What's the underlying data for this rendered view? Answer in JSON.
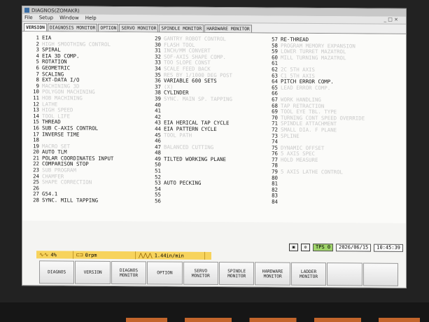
{
  "window": {
    "title": "DIAGNOS(ZOMAKR)",
    "controls": "_ □ ×"
  },
  "menu": [
    "File",
    "Setup",
    "Window",
    "Help"
  ],
  "tabs": [
    {
      "label": "VERSION",
      "active": true
    },
    {
      "label": "DIAGNOSIS MONITOR",
      "active": false
    },
    {
      "label": "OPTION",
      "active": false
    },
    {
      "label": "SERVO MONITOR",
      "active": false
    },
    {
      "label": "SPINDLE MONITOR",
      "active": false
    },
    {
      "label": "HARDWARE MONITOR",
      "active": false
    }
  ],
  "options_col1": [
    {
      "num": "1",
      "label": "EIA",
      "enabled": true
    },
    {
      "num": "2",
      "label": "HIGH SMOOTHING CONTROL",
      "enabled": false
    },
    {
      "num": "3",
      "label": "SPIRAL",
      "enabled": true
    },
    {
      "num": "4",
      "label": "EIA 3D COMP.",
      "enabled": true
    },
    {
      "num": "5",
      "label": "ROTATION",
      "enabled": true
    },
    {
      "num": "6",
      "label": "GEOMETRIC",
      "enabled": true
    },
    {
      "num": "7",
      "label": "SCALING",
      "enabled": true
    },
    {
      "num": "8",
      "label": "EXT-DATA I/O",
      "enabled": true
    },
    {
      "num": "9",
      "label": "MACHINING 3D",
      "enabled": false
    },
    {
      "num": "10",
      "label": "POLYGON MACHINING",
      "enabled": false
    },
    {
      "num": "11",
      "label": "HOB MACHINING",
      "enabled": false
    },
    {
      "num": "12",
      "label": "LATHE",
      "enabled": false
    },
    {
      "num": "13",
      "label": "HIGH SPEED",
      "enabled": false
    },
    {
      "num": "14",
      "label": "TOOL LIFE",
      "enabled": false
    },
    {
      "num": "15",
      "label": "THREAD",
      "enabled": true
    },
    {
      "num": "16",
      "label": "SUB C-AXIS CONTROL",
      "enabled": true
    },
    {
      "num": "17",
      "label": "INVERSE TIME",
      "enabled": true
    },
    {
      "num": "18",
      "label": "",
      "enabled": true
    },
    {
      "num": "19",
      "label": "MACRO SET",
      "enabled": false
    },
    {
      "num": "20",
      "label": "AUTO TLM",
      "enabled": true
    },
    {
      "num": "21",
      "label": "POLAR COORDINATES INPUT",
      "enabled": true
    },
    {
      "num": "22",
      "label": "COMPARISON STOP",
      "enabled": true
    },
    {
      "num": "23",
      "label": "SUB PROGRAM",
      "enabled": false
    },
    {
      "num": "24",
      "label": "CHAMFER",
      "enabled": false
    },
    {
      "num": "25",
      "label": "SHAPE CORRECTION",
      "enabled": false
    },
    {
      "num": "26",
      "label": "",
      "enabled": true
    },
    {
      "num": "27",
      "label": "G54.1",
      "enabled": true
    },
    {
      "num": "28",
      "label": "SYNC. MILL TAPPING",
      "enabled": true
    }
  ],
  "options_col2": [
    {
      "num": "29",
      "label": "GANTRY ROBOT CONTROL",
      "enabled": false
    },
    {
      "num": "30",
      "label": "FLASH TOOL",
      "enabled": false
    },
    {
      "num": "31",
      "label": "INCH/MM CONVERT",
      "enabled": false
    },
    {
      "num": "32",
      "label": "SOF-AXIS SHAPE COMP.",
      "enabled": false
    },
    {
      "num": "33",
      "label": "TOO SLOPE CONST",
      "enabled": false
    },
    {
      "num": "34",
      "label": "SCALE FEED BACK",
      "enabled": false
    },
    {
      "num": "35",
      "label": "RES BY 1/1000 DEG POST",
      "enabled": false
    },
    {
      "num": "36",
      "label": "VARIABLE 600 SETS",
      "enabled": true
    },
    {
      "num": "37",
      "label": "(X)",
      "enabled": false
    },
    {
      "num": "38",
      "label": "CYLINDER",
      "enabled": true
    },
    {
      "num": "39",
      "label": "SYNC. MAIN SP. TAPPING",
      "enabled": false
    },
    {
      "num": "40",
      "label": "",
      "enabled": true
    },
    {
      "num": "41",
      "label": "",
      "enabled": true
    },
    {
      "num": "42",
      "label": "",
      "enabled": true
    },
    {
      "num": "43",
      "label": "EIA HERICAL TAP CYCLE",
      "enabled": true
    },
    {
      "num": "44",
      "label": "EIA PATTERN CYCLE",
      "enabled": true
    },
    {
      "num": "45",
      "label": "TOOL PATH",
      "enabled": false
    },
    {
      "num": "46",
      "label": "",
      "enabled": true
    },
    {
      "num": "47",
      "label": "BALANCED CUTTING",
      "enabled": false
    },
    {
      "num": "48",
      "label": "",
      "enabled": true
    },
    {
      "num": "49",
      "label": "TILTED WORKING PLANE",
      "enabled": true
    },
    {
      "num": "50",
      "label": "",
      "enabled": true
    },
    {
      "num": "51",
      "label": "",
      "enabled": true
    },
    {
      "num": "52",
      "label": "",
      "enabled": true
    },
    {
      "num": "53",
      "label": "AUTO PECKING",
      "enabled": true
    },
    {
      "num": "54",
      "label": "",
      "enabled": true
    },
    {
      "num": "55",
      "label": "",
      "enabled": true
    },
    {
      "num": "56",
      "label": "",
      "enabled": true
    }
  ],
  "options_col3": [
    {
      "num": "57",
      "label": "RE-THREAD",
      "enabled": true
    },
    {
      "num": "58",
      "label": "PROGRAM MEMORY EXPANSION",
      "enabled": false
    },
    {
      "num": "59",
      "label": "LOWER TURRET MAZATROL",
      "enabled": false
    },
    {
      "num": "60",
      "label": "MILL TURNING MAZATROL",
      "enabled": false
    },
    {
      "num": "61",
      "label": "",
      "enabled": true
    },
    {
      "num": "62",
      "label": "2C 5TH AXIS",
      "enabled": false
    },
    {
      "num": "63",
      "label": "C1 5TH AXIS",
      "enabled": false
    },
    {
      "num": "64",
      "label": "PITCH ERROR COMP.",
      "enabled": true
    },
    {
      "num": "65",
      "label": "LEAD ERROR COMP.",
      "enabled": false
    },
    {
      "num": "66",
      "label": "",
      "enabled": true
    },
    {
      "num": "67",
      "label": "WORK HANDLING",
      "enabled": false
    },
    {
      "num": "68",
      "label": "TAP RETRACTION",
      "enabled": false
    },
    {
      "num": "69",
      "label": "TOOL EYE TBL. TYPE",
      "enabled": false
    },
    {
      "num": "70",
      "label": "TURNING CONT SPEED OVERRIDE",
      "enabled": false
    },
    {
      "num": "71",
      "label": "SPINDLE ATTACHMENT",
      "enabled": false
    },
    {
      "num": "72",
      "label": "SMALL DIA. F PLANE",
      "enabled": false
    },
    {
      "num": "73",
      "label": "SPLINE",
      "enabled": false
    },
    {
      "num": "74",
      "label": "",
      "enabled": true
    },
    {
      "num": "75",
      "label": "DYNAMIC OFFSET",
      "enabled": false
    },
    {
      "num": "76",
      "label": "5 AXIS SPEC",
      "enabled": false
    },
    {
      "num": "77",
      "label": "HOLD MEASURE",
      "enabled": false
    },
    {
      "num": "78",
      "label": "",
      "enabled": true
    },
    {
      "num": "79",
      "label": "5 AXIS LATHE CONTROL",
      "enabled": false
    },
    {
      "num": "80",
      "label": "",
      "enabled": true
    },
    {
      "num": "81",
      "label": "",
      "enabled": true
    },
    {
      "num": "82",
      "label": "",
      "enabled": true
    },
    {
      "num": "83",
      "label": "",
      "enabled": true
    },
    {
      "num": "84",
      "label": "",
      "enabled": true
    }
  ],
  "status": {
    "tps": "TPS 0",
    "date": "2026/06/15",
    "time": "10:45:39"
  },
  "yellowbar": {
    "load": "4%",
    "spindle": "0rpm",
    "feed": "1.44in/min"
  },
  "softkeys": [
    {
      "line1": "DIAGNOS",
      "line2": ""
    },
    {
      "line1": "VERSION",
      "line2": ""
    },
    {
      "line1": "DIAGNOS",
      "line2": "MONITOR"
    },
    {
      "line1": "OPTION",
      "line2": ""
    },
    {
      "line1": "SERVO",
      "line2": "MONITOR"
    },
    {
      "line1": "SPINDLE",
      "line2": "MONITOR"
    },
    {
      "line1": "HARDWARE",
      "line2": "MONITOR"
    },
    {
      "line1": "LADDER",
      "line2": "MONITOR"
    },
    {
      "line1": "",
      "line2": ""
    },
    {
      "line1": "",
      "line2": ""
    }
  ]
}
